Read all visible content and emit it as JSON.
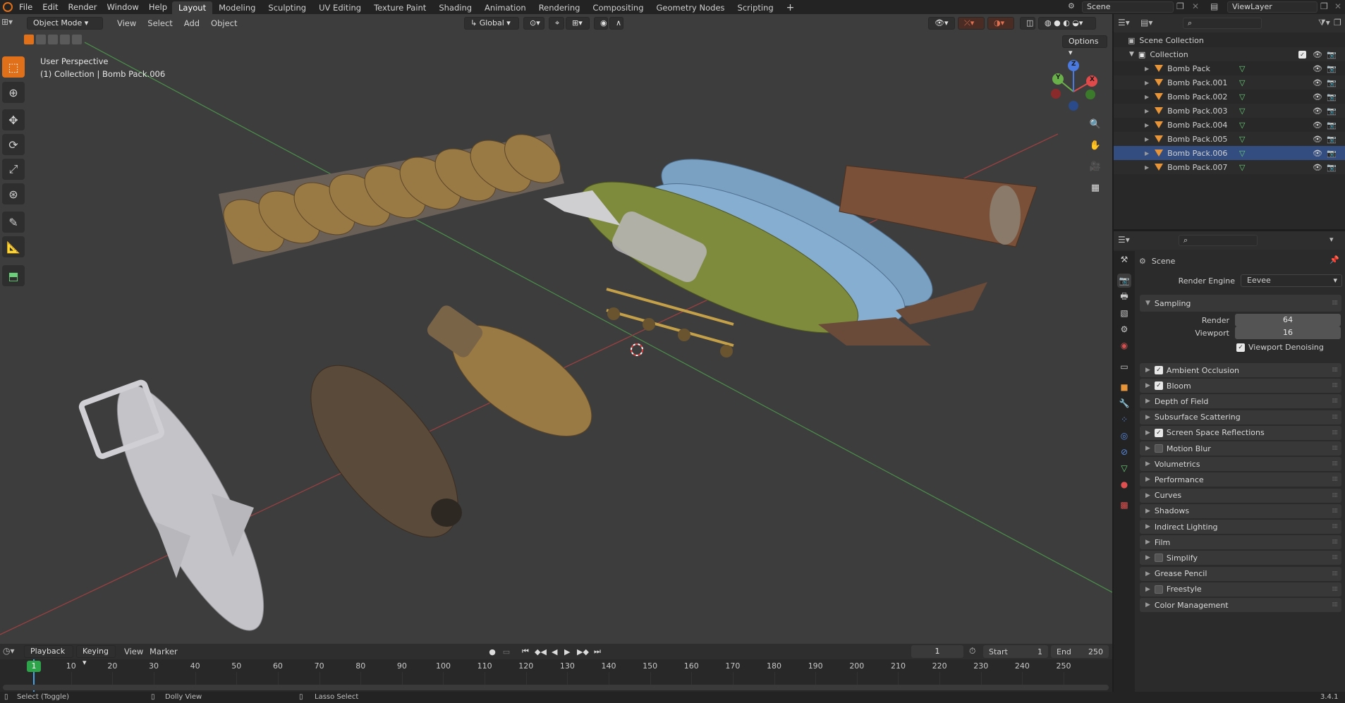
{
  "topbar": {
    "menu": [
      "File",
      "Edit",
      "Render",
      "Window",
      "Help"
    ],
    "workspaces": [
      "Layout",
      "Modeling",
      "Sculpting",
      "UV Editing",
      "Texture Paint",
      "Shading",
      "Animation",
      "Rendering",
      "Compositing",
      "Geometry Nodes",
      "Scripting"
    ],
    "active_workspace": "Layout",
    "scene": "Scene",
    "view_layer": "ViewLayer"
  },
  "viewport": {
    "mode": "Object Mode",
    "menus": [
      "View",
      "Select",
      "Add",
      "Object"
    ],
    "transform_orientation": "Global",
    "options_label": "Options",
    "overlay_title": "User Perspective",
    "overlay_subtitle": "(1) Collection | Bomb Pack.006",
    "gizmo_axes": [
      "X",
      "Y",
      "Z"
    ],
    "tools": [
      "select-box",
      "cursor",
      "move",
      "rotate",
      "scale",
      "transform",
      "annotate",
      "measure",
      "add-cube"
    ]
  },
  "outliner": {
    "root": "Scene Collection",
    "collection": "Collection",
    "objects": [
      "Bomb Pack",
      "Bomb Pack.001",
      "Bomb Pack.002",
      "Bomb Pack.003",
      "Bomb Pack.004",
      "Bomb Pack.005",
      "Bomb Pack.006",
      "Bomb Pack.007"
    ],
    "selected": "Bomb Pack.006"
  },
  "properties": {
    "context": "Scene",
    "render_engine_label": "Render Engine",
    "render_engine": "Eevee",
    "sampling_label": "Sampling",
    "render_label": "Render",
    "render_samples": "64",
    "viewport_label": "Viewport",
    "viewport_samples": "16",
    "viewport_denoising_label": "Viewport Denoising",
    "viewport_denoising": true,
    "panels": [
      {
        "label": "Ambient Occlusion",
        "checkbox": true,
        "checked": true
      },
      {
        "label": "Bloom",
        "checkbox": true,
        "checked": true
      },
      {
        "label": "Depth of Field",
        "checkbox": false
      },
      {
        "label": "Subsurface Scattering",
        "checkbox": false
      },
      {
        "label": "Screen Space Reflections",
        "checkbox": true,
        "checked": true
      },
      {
        "label": "Motion Blur",
        "checkbox": true,
        "checked": false
      },
      {
        "label": "Volumetrics",
        "checkbox": false
      },
      {
        "label": "Performance",
        "checkbox": false
      },
      {
        "label": "Curves",
        "checkbox": false
      },
      {
        "label": "Shadows",
        "checkbox": false
      },
      {
        "label": "Indirect Lighting",
        "checkbox": false
      },
      {
        "label": "Film",
        "checkbox": false
      },
      {
        "label": "Simplify",
        "checkbox": true,
        "checked": false
      },
      {
        "label": "Grease Pencil",
        "checkbox": false
      },
      {
        "label": "Freestyle",
        "checkbox": true,
        "checked": false
      },
      {
        "label": "Color Management",
        "checkbox": false
      }
    ]
  },
  "timeline": {
    "menus": [
      "Playback",
      "Keying",
      "View",
      "Marker"
    ],
    "current_frame": "1",
    "start_label": "Start",
    "start": "1",
    "end_label": "End",
    "end": "250",
    "ticks": [
      "1",
      "10",
      "20",
      "30",
      "40",
      "50",
      "60",
      "70",
      "80",
      "90",
      "100",
      "110",
      "120",
      "130",
      "140",
      "150",
      "160",
      "170",
      "180",
      "190",
      "200",
      "210",
      "220",
      "230",
      "240",
      "250"
    ]
  },
  "statusbar": {
    "left": "Select (Toggle)",
    "middle": "Dolly View",
    "right": "Lasso Select",
    "version": "3.4.1"
  },
  "colors": {
    "accent": "#e0701a",
    "selection": "#334d80",
    "axis_x": "#b04040",
    "axis_y": "#4a9a4a"
  }
}
